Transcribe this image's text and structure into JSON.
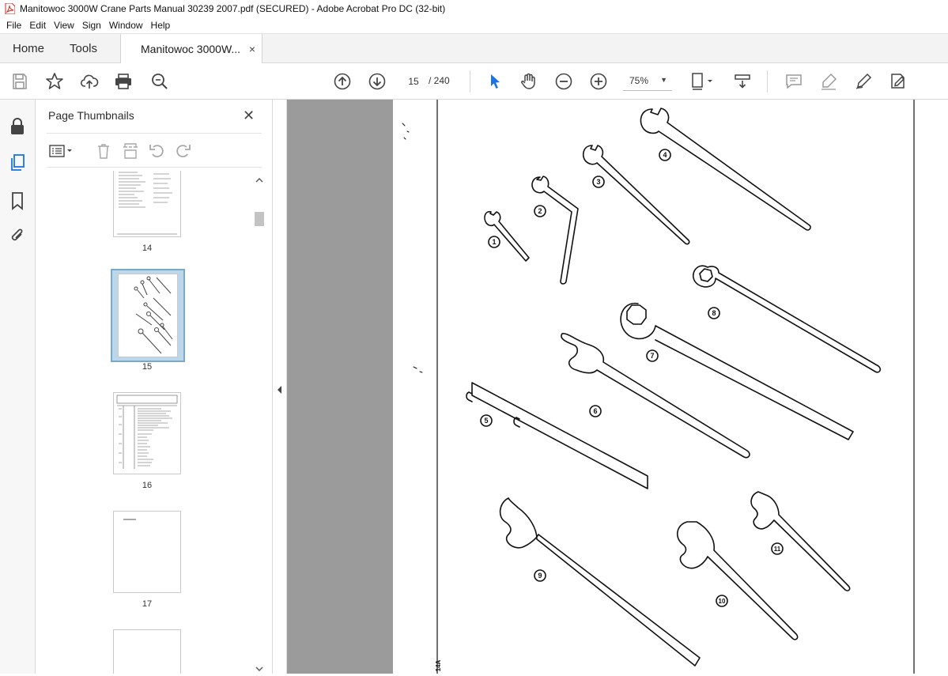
{
  "window": {
    "title": "Manitowoc 3000W Crane Parts Manual 30239 2007.pdf (SECURED) - Adobe Acrobat Pro DC (32-bit)",
    "min_glyph": "—",
    "max_glyph": "□",
    "close_glyph": "✕"
  },
  "menu": [
    "File",
    "Edit",
    "View",
    "Sign",
    "Window",
    "Help"
  ],
  "tabs": {
    "home": "Home",
    "tools": "Tools",
    "document": "Manitowoc 3000W...",
    "close": "×"
  },
  "toolbar": {
    "current_page": "15",
    "total_pages": "/ 240",
    "zoom": "75%",
    "zoom_caret": "▼"
  },
  "panel": {
    "title": "Page Thumbnails",
    "close": "✕",
    "thumbnails": [
      {
        "label": "14",
        "selected": false
      },
      {
        "label": "15",
        "selected": true
      },
      {
        "label": "16",
        "selected": false
      },
      {
        "label": "17",
        "selected": false
      },
      {
        "label": "",
        "selected": false
      }
    ]
  },
  "page_content": {
    "callouts": [
      "1",
      "2",
      "3",
      "4",
      "5",
      "6",
      "7",
      "8",
      "9",
      "10",
      "11"
    ],
    "margin_label": "14A"
  },
  "colors": {
    "accent": "#1a73e8",
    "thumbnail_selected": "#bcd7ea",
    "pdf_icon": "#d7261e",
    "doc_background": "#9b9b9b"
  },
  "icons": {
    "save": "save-icon",
    "bookmark_star": "star-icon",
    "upload": "cloud-upload-icon",
    "print": "printer-icon",
    "search": "magnifier-icon",
    "prev": "arrow-up-circle-icon",
    "next": "arrow-down-circle-icon",
    "select": "pointer-icon",
    "hand": "hand-icon",
    "zoom_out": "zoom-out-icon",
    "zoom_in": "zoom-in-icon"
  }
}
